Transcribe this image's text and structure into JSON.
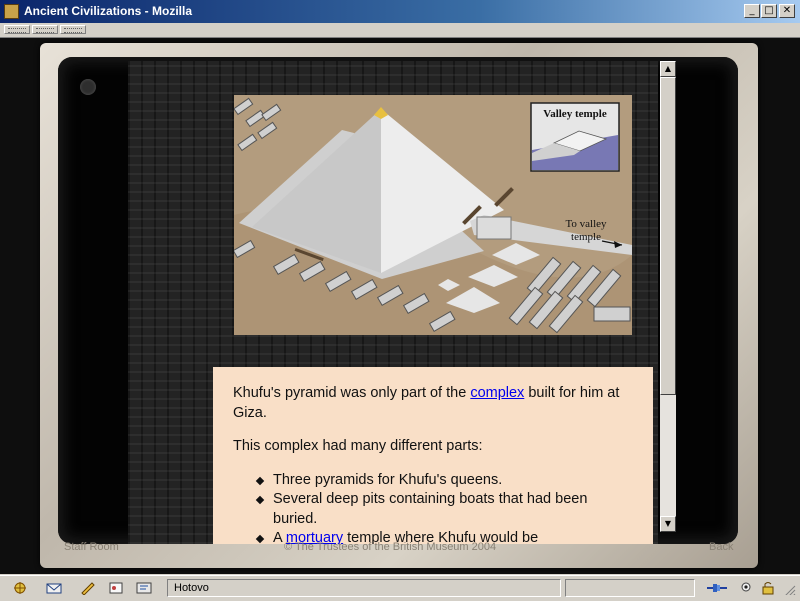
{
  "window": {
    "title": "Ancient Civilizations - Mozilla",
    "minimize_glyph": "_",
    "maximize_glyph": "□",
    "close_glyph": "✕"
  },
  "picture": {
    "inset_label": "Valley temple",
    "arrow_label_line1": "To valley",
    "arrow_label_line2": "temple",
    "colors": {
      "sand": "#b39c7e",
      "pyramid": "#e4e4e4",
      "capstone": "#e8c040",
      "inset_water": "#7878b4"
    }
  },
  "content": {
    "para1_before": "Khufu's pyramid was only part of the ",
    "para1_link": "complex",
    "para1_after": " built for him at Giza.",
    "para2": "This complex had many different parts:",
    "bullet1": "Three pyramids for Khufu's queens.",
    "bullet2": "Several deep pits containing boats that had been buried.",
    "bullet3_before": "A ",
    "bullet3_link": "mortuary",
    "bullet3_after": " temple where Khufu would be"
  },
  "footer": {
    "staff_room": "Staff Room",
    "copyright": "© The Trustees of the British Museum 2004",
    "back": "Back"
  },
  "scrollbar": {
    "up_glyph": "▲",
    "down_glyph": "▼"
  },
  "statusbar": {
    "status_text": "Hotovo"
  },
  "colors": {
    "panel": "#f9dfc7",
    "link": "#0000ee",
    "titlebar": "#0a246a"
  }
}
